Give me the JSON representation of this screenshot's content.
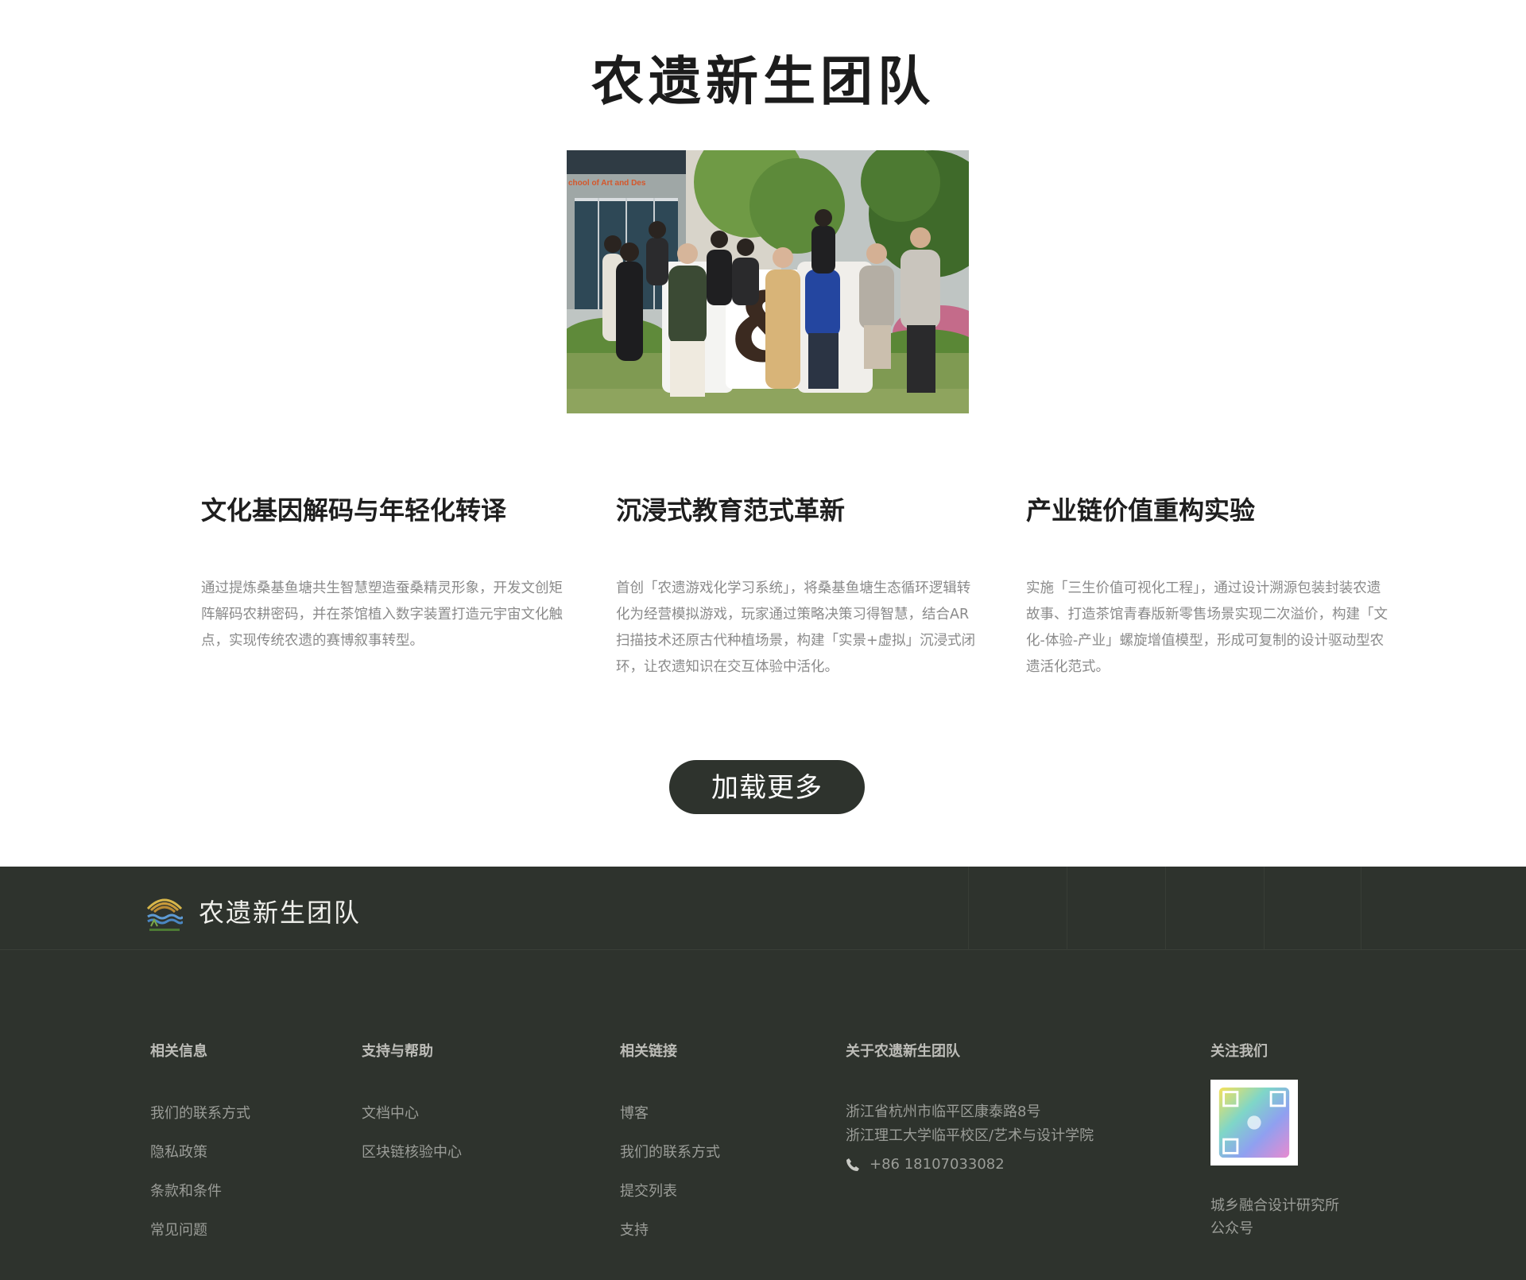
{
  "team": {
    "title": "农遗新生团队",
    "photo_sign_text": "chool of Art and Des"
  },
  "features": [
    {
      "title": "文化基因解码与年轻化转译",
      "description": "通过提炼桑基鱼塘共生智慧塑造蚕桑精灵形象，开发文创矩阵解码农耕密码，并在茶馆植入数字装置打造元宇宙文化触点，实现传统农遗的赛博叙事转型。"
    },
    {
      "title": "沉浸式教育范式革新",
      "description": "首创「农遗游戏化学习系统」，将桑基鱼塘生态循环逻辑转化为经营模拟游戏，玩家通过策略决策习得智慧，结合AR扫描技术还原古代种植场景，构建「实景+虚拟」沉浸式闭环，让农遗知识在交互体验中活化。"
    },
    {
      "title": "产业链价值重构实验",
      "description": "实施「三生价值可视化工程」，通过设计溯源包装封装农遗故事、打造茶馆青春版新零售场景实现二次溢价，构建「文化-体验-产业」螺旋增值模型，形成可复制的设计驱动型农遗活化范式。"
    }
  ],
  "load_more_label": "加载更多",
  "footer": {
    "brand": "农遗新生团队",
    "columns": {
      "related_info": {
        "title": "相关信息",
        "links": [
          "我们的联系方式",
          "隐私政策",
          "条款和条件",
          "常见问题"
        ]
      },
      "support": {
        "title": "支持与帮助",
        "links": [
          "文档中心",
          "区块链核验中心"
        ]
      },
      "related_links": {
        "title": "相关链接",
        "links": [
          "博客",
          "我们的联系方式",
          "提交列表",
          "支持"
        ]
      },
      "about": {
        "title": "关于农遗新生团队",
        "address_line1": "浙江省杭州市临平区康泰路8号",
        "address_line2": "浙江理工大学临平校区/艺术与设计学院",
        "phone": "+86 18107033082"
      },
      "follow": {
        "title": "关注我们",
        "caption_line1": "城乡融合设计研究所",
        "caption_line2": "公众号"
      }
    }
  },
  "colors": {
    "footer_bg": "#2e332d",
    "button_bg": "#2e332d",
    "title_text": "#1c1c1c",
    "body_text_muted": "#8a8a8a"
  },
  "icons": {
    "phone": "phone-icon",
    "logo": "rice-terrace-logo-icon",
    "qr": "qr-code-icon"
  }
}
